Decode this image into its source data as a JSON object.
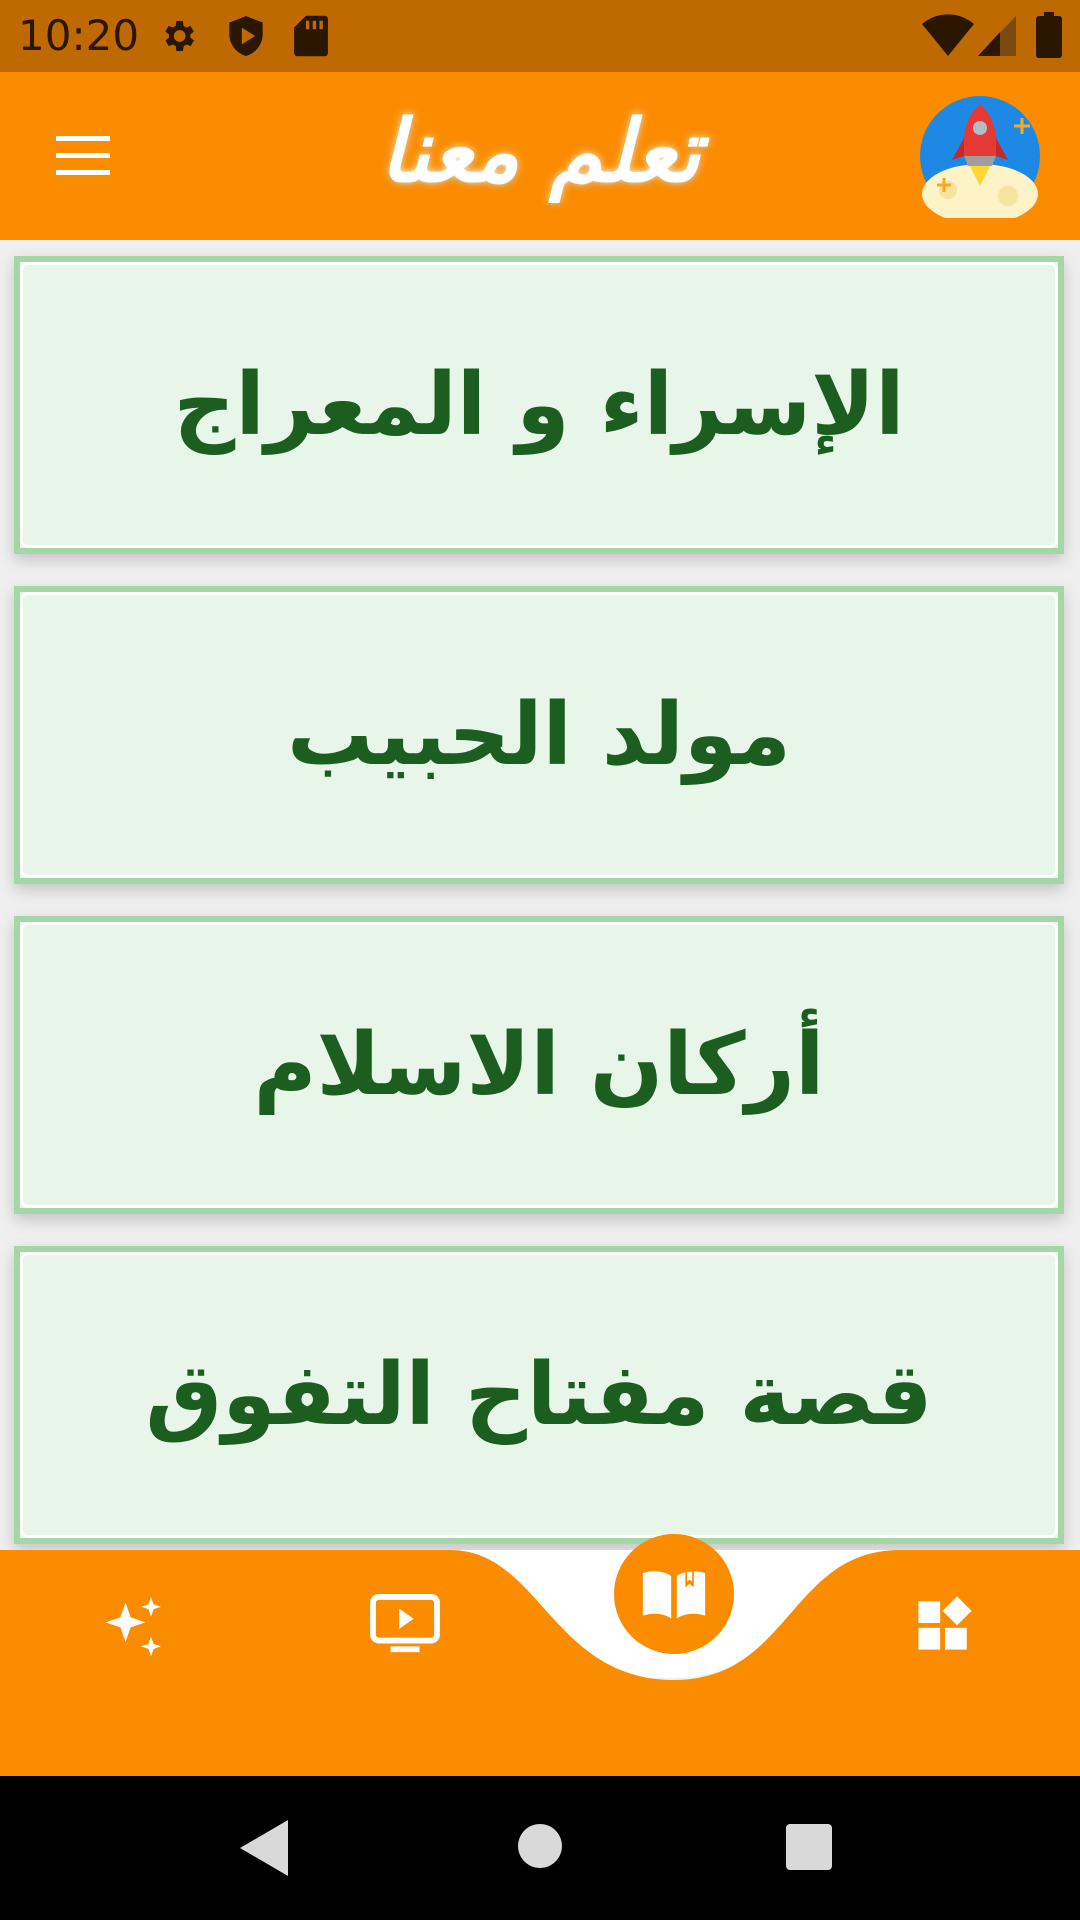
{
  "status_bar": {
    "time": "10:20",
    "icons": [
      "settings-icon",
      "shield-play-icon",
      "sd-card-icon",
      "wifi-icon",
      "signal-icon",
      "battery-icon"
    ]
  },
  "app_bar": {
    "title": "تعلم معنا",
    "menu_icon": "menu-icon",
    "avatar_icon": "rocket-avatar-icon",
    "color": "#fb8c00"
  },
  "cards": [
    {
      "label": "الإسراء و المعراج"
    },
    {
      "label": "مولد الحبيب"
    },
    {
      "label": "أركان الاسلام"
    },
    {
      "label": "قصة مفتاح التفوق"
    }
  ],
  "bottom_nav": {
    "items": [
      "sparkles-icon",
      "video-icon",
      "book-icon",
      "widgets-icon"
    ],
    "selected": "book-icon"
  },
  "colors": {
    "accent": "#fb8c00",
    "status_bar": "#bf6a00",
    "card_bg": "#e8f5e9",
    "card_border": "#a5d6a7",
    "card_text": "#1b5e20"
  }
}
